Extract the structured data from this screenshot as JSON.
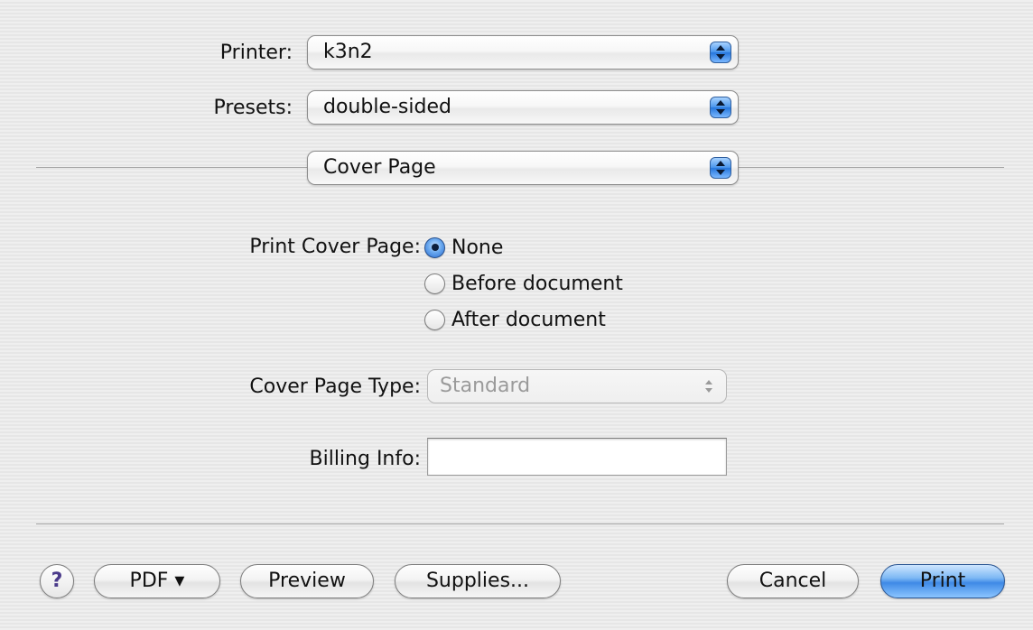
{
  "printer": {
    "label": "Printer:",
    "value": "k3n2"
  },
  "presets": {
    "label": "Presets:",
    "value": "double-sided"
  },
  "panel": {
    "value": "Cover Page"
  },
  "cover_page": {
    "label": "Print Cover Page:",
    "options": [
      {
        "label": "None",
        "selected": true
      },
      {
        "label": "Before document",
        "selected": false
      },
      {
        "label": "After document",
        "selected": false
      }
    ]
  },
  "cover_type": {
    "label": "Cover Page Type:",
    "value": "Standard",
    "enabled": false
  },
  "billing": {
    "label": "Billing Info:",
    "value": ""
  },
  "buttons": {
    "help": "?",
    "pdf": "PDF ▾",
    "preview": "Preview",
    "supplies": "Supplies...",
    "cancel": "Cancel",
    "print": "Print"
  },
  "icons": {
    "popup_arrows": "up-down-arrows-icon",
    "help": "question-mark-icon"
  },
  "colors": {
    "accent": "#3f8ae6",
    "background": "#ececec"
  }
}
